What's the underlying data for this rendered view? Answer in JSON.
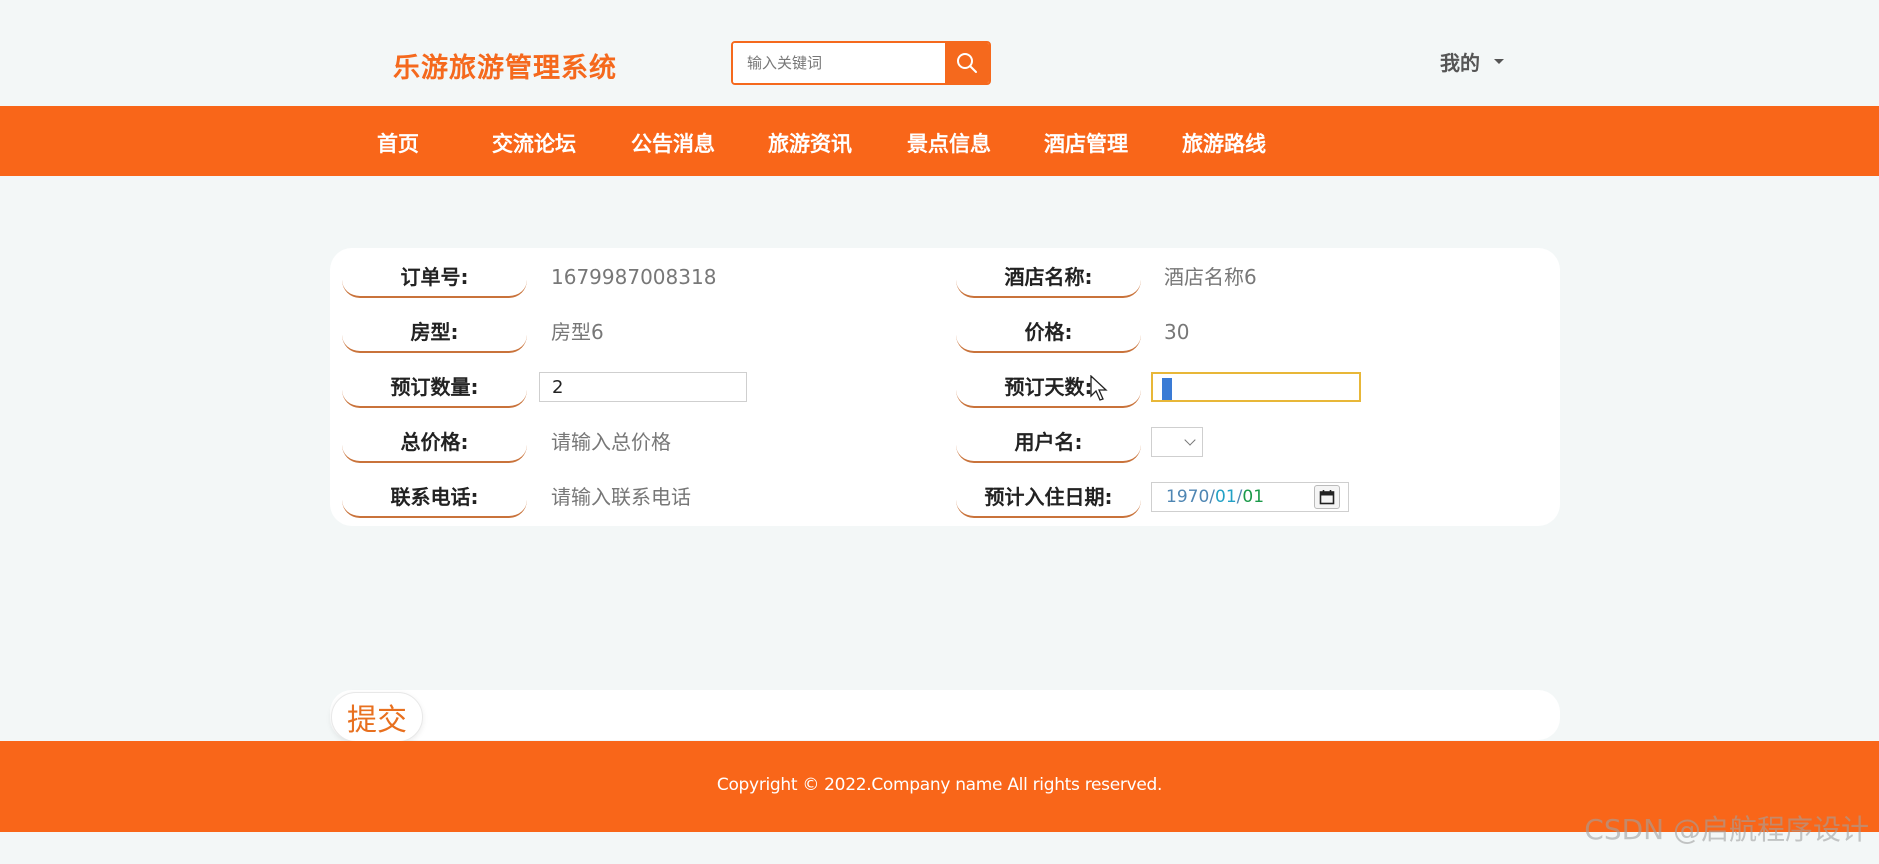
{
  "header": {
    "brand": "乐游旅游管理系统",
    "search_placeholder": "输入关键词",
    "user_menu": "我的"
  },
  "nav": {
    "items": [
      "首页",
      "交流论坛",
      "公告消息",
      "旅游资讯",
      "景点信息",
      "酒店管理",
      "旅游路线"
    ]
  },
  "form": {
    "order_no_label": "订单号:",
    "order_no_value": "1679987008318",
    "hotel_name_label": "酒店名称:",
    "hotel_name_value": "酒店名称6",
    "room_type_label": "房型:",
    "room_type_value": "房型6",
    "price_label": "价格:",
    "price_value": "30",
    "quantity_label": "预订数量:",
    "quantity_value": "2",
    "days_label": "预订天数:",
    "days_value": "0",
    "total_label": "总价格:",
    "total_placeholder": "请输入总价格",
    "username_label": "用户名:",
    "phone_label": "联系电话:",
    "phone_placeholder": "请输入联系电话",
    "checkin_label": "预计入住日期:",
    "checkin_year": "1970",
    "checkin_month": "01",
    "checkin_day": "01"
  },
  "submit_label": "提交",
  "footer": {
    "copyright": "Copyright © 2022.Company name All rights reserved."
  },
  "watermark": "CSDN @启航程序设计",
  "colors": {
    "brand_orange": "#f96619",
    "page_bg": "#f3f7f7"
  }
}
